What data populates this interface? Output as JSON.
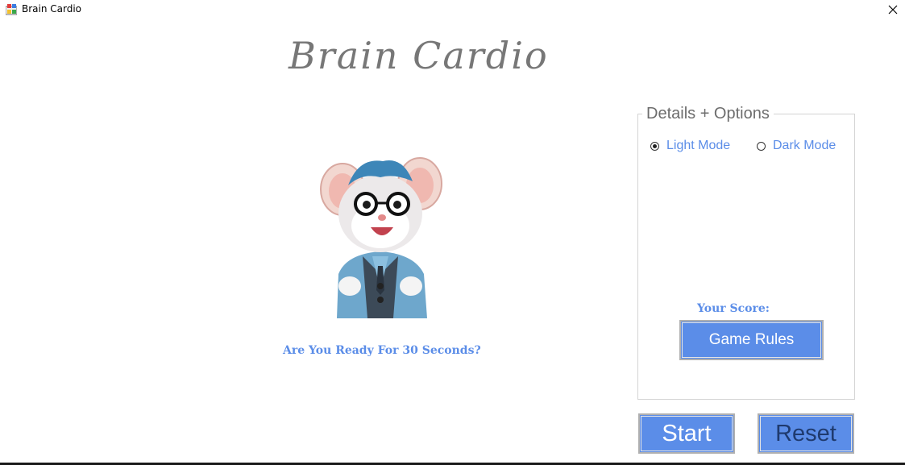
{
  "window": {
    "title": "Brain Cardio",
    "icon": "app-icon",
    "close_icon": "close-icon"
  },
  "main": {
    "heading": "Brain Cardio",
    "mascot_image": "mouse-mascot-image",
    "prompt": "Are You Ready For 30 Seconds?"
  },
  "options": {
    "legend": "Details + Options",
    "light_mode_label": "Light Mode",
    "dark_mode_label": "Dark Mode",
    "selected": "Light Mode",
    "score_label": "Your Score:",
    "rules_button": "Game Rules"
  },
  "actions": {
    "start": "Start",
    "reset": "Reset"
  },
  "colors": {
    "accent": "#5b8de8",
    "heading": "#777777",
    "reset_text": "#1f3a6e"
  }
}
